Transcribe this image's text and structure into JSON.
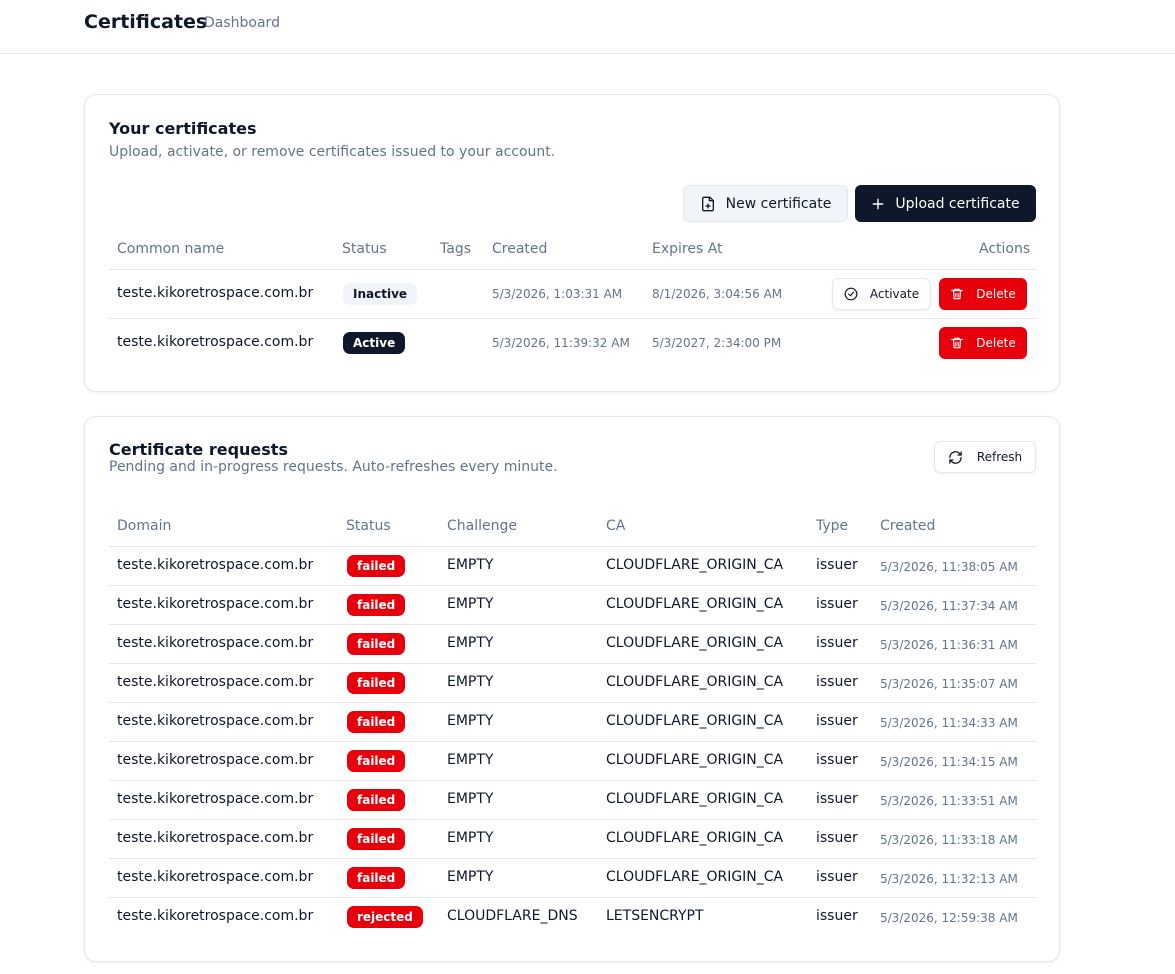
{
  "header": {
    "title": "Certificates",
    "nav_dashboard": "Dashboard"
  },
  "certificates": {
    "title": "Your certificates",
    "subtitle": "Upload, activate, or remove certificates issued to your account.",
    "new_button": "New certificate",
    "upload_button": "Upload certificate",
    "columns": [
      "Common name",
      "Status",
      "Tags",
      "Created",
      "Expires At",
      "Actions"
    ],
    "rows": [
      {
        "name": "teste.kikoretrospace.com.br",
        "status": "Inactive",
        "created": "5/3/2026, 1:03:31 AM",
        "expires": "8/1/2026, 3:04:56 AM",
        "activate": "Activate",
        "delete": "Delete"
      },
      {
        "name": "teste.kikoretrospace.com.br",
        "status": "Active",
        "created": "5/3/2026, 11:39:32 AM",
        "expires": "5/3/2027, 2:34:00 PM",
        "delete": "Delete"
      }
    ]
  },
  "requests": {
    "title": "Certificate requests",
    "subtitle": "Pending and in-progress requests. Auto-refreshes every minute.",
    "refresh_button": "Refresh",
    "columns": [
      "Domain",
      "Status",
      "Challenge",
      "CA",
      "Type",
      "Created"
    ],
    "rows": [
      {
        "domain": "teste.kikoretrospace.com.br",
        "status": "failed",
        "challenge": "EMPTY",
        "ca": "CLOUDFLARE_ORIGIN_CA",
        "type": "issuer",
        "created": "5/3/2026, 11:38:05 AM"
      },
      {
        "domain": "teste.kikoretrospace.com.br",
        "status": "failed",
        "challenge": "EMPTY",
        "ca": "CLOUDFLARE_ORIGIN_CA",
        "type": "issuer",
        "created": "5/3/2026, 11:37:34 AM"
      },
      {
        "domain": "teste.kikoretrospace.com.br",
        "status": "failed",
        "challenge": "EMPTY",
        "ca": "CLOUDFLARE_ORIGIN_CA",
        "type": "issuer",
        "created": "5/3/2026, 11:36:31 AM"
      },
      {
        "domain": "teste.kikoretrospace.com.br",
        "status": "failed",
        "challenge": "EMPTY",
        "ca": "CLOUDFLARE_ORIGIN_CA",
        "type": "issuer",
        "created": "5/3/2026, 11:35:07 AM"
      },
      {
        "domain": "teste.kikoretrospace.com.br",
        "status": "failed",
        "challenge": "EMPTY",
        "ca": "CLOUDFLARE_ORIGIN_CA",
        "type": "issuer",
        "created": "5/3/2026, 11:34:33 AM"
      },
      {
        "domain": "teste.kikoretrospace.com.br",
        "status": "failed",
        "challenge": "EMPTY",
        "ca": "CLOUDFLARE_ORIGIN_CA",
        "type": "issuer",
        "created": "5/3/2026, 11:34:15 AM"
      },
      {
        "domain": "teste.kikoretrospace.com.br",
        "status": "failed",
        "challenge": "EMPTY",
        "ca": "CLOUDFLARE_ORIGIN_CA",
        "type": "issuer",
        "created": "5/3/2026, 11:33:51 AM"
      },
      {
        "domain": "teste.kikoretrospace.com.br",
        "status": "failed",
        "challenge": "EMPTY",
        "ca": "CLOUDFLARE_ORIGIN_CA",
        "type": "issuer",
        "created": "5/3/2026, 11:33:18 AM"
      },
      {
        "domain": "teste.kikoretrospace.com.br",
        "status": "failed",
        "challenge": "EMPTY",
        "ca": "CLOUDFLARE_ORIGIN_CA",
        "type": "issuer",
        "created": "5/3/2026, 11:32:13 AM"
      },
      {
        "domain": "teste.kikoretrospace.com.br",
        "status": "rejected",
        "challenge": "CLOUDFLARE_DNS",
        "ca": "LETSENCRYPT",
        "type": "issuer",
        "created": "5/3/2026, 12:59:38 AM"
      }
    ]
  },
  "icons": {
    "new": "file-plus-icon",
    "upload": "plus-icon",
    "activate": "check-circle-icon",
    "delete": "trash-icon",
    "refresh": "refresh-icon"
  },
  "colors": {
    "primary": "#0f172a",
    "danger": "#e7000b",
    "muted": "#64748b",
    "border": "#e2e8f0"
  }
}
